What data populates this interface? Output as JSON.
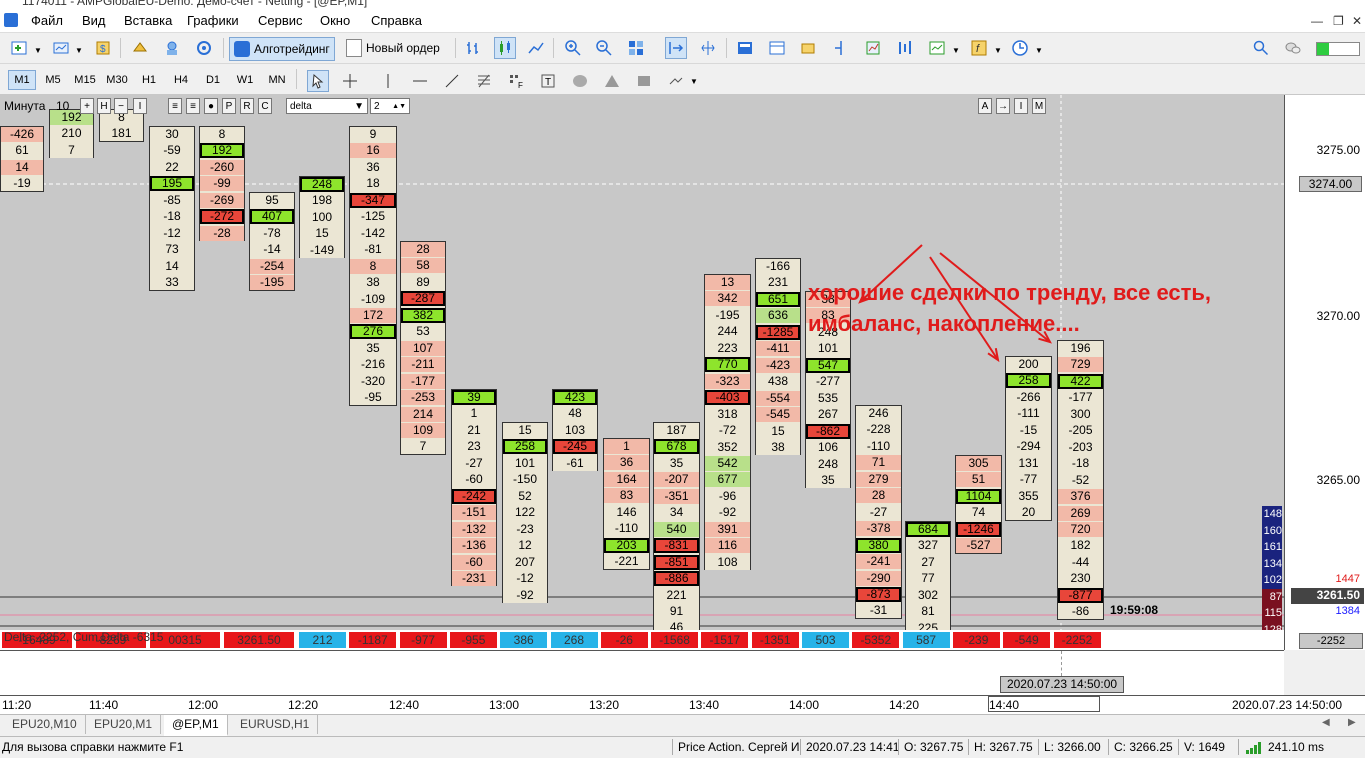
{
  "window": {
    "title": "1174011 - AMPGlobalEU-Demo: Демо-счет - Netting - [@EP,M1]"
  },
  "menu": [
    "Файл",
    "Вид",
    "Вставка",
    "Графики",
    "Сервис",
    "Окно",
    "Справка"
  ],
  "toolbar": {
    "algotrading_label": "Алготрейдинг",
    "new_order_label": "Новый ордер"
  },
  "timeframes": [
    "M1",
    "M5",
    "M15",
    "M30",
    "H1",
    "H4",
    "D1",
    "W1",
    "MN"
  ],
  "chart_controls": {
    "period_label": "Минута",
    "period_value": "10",
    "indicator": "delta",
    "indicator_value": "2",
    "buttons": [
      "+",
      "H",
      "−",
      "I",
      "≡",
      "≡",
      "●",
      "P",
      "R",
      "C"
    ],
    "right_buttons": [
      "A",
      "→",
      "I",
      "M"
    ]
  },
  "price_scale": {
    "labels": [
      "3275.00",
      "3274.00",
      "3270.00",
      "3265.00",
      "3261.50"
    ],
    "current_price": "3261.50",
    "crosshair_price": "3274.00",
    "volume_labels": [
      "148",
      "160",
      "161",
      "134",
      "102",
      "87",
      "115",
      "128"
    ],
    "right_values": [
      "1447",
      "1384"
    ],
    "delta_scale": "-2252"
  },
  "annotation": {
    "line1": "хорошие сделки по тренду, все есть,",
    "line2": "имбаланс, накопление...."
  },
  "footprint": [
    {
      "cells": [
        "-426",
        "61",
        "14",
        "-19"
      ],
      "colors": [
        "r",
        "w",
        "r",
        "w"
      ]
    },
    {
      "cells": [
        "192",
        "210",
        "7"
      ],
      "colors": [
        "g",
        "w",
        "w"
      ]
    },
    {
      "cells": [
        "8",
        "181"
      ],
      "colors": [
        "w",
        "w"
      ]
    },
    {
      "cells": [
        "30",
        "-59",
        "22",
        "195",
        "-85",
        "-18",
        "-12",
        "73",
        "14",
        "33"
      ],
      "colors": [
        "w",
        "w",
        "w",
        "G",
        "w",
        "w",
        "w",
        "w",
        "w",
        "w"
      ]
    },
    {
      "cells": [
        "8",
        "192",
        "-260",
        "-99",
        "-269",
        "-272",
        "-28"
      ],
      "colors": [
        "w",
        "G",
        "r",
        "r",
        "r",
        "R",
        "r"
      ]
    },
    {
      "cells": [
        "95",
        "407",
        "-78",
        "-14",
        "-254",
        "-195"
      ],
      "colors": [
        "w",
        "G",
        "w",
        "w",
        "r",
        "r"
      ]
    },
    {
      "cells": [
        "248",
        "198",
        "100",
        "15",
        "-149"
      ],
      "colors": [
        "G",
        "w",
        "w",
        "w",
        "w"
      ]
    },
    {
      "cells": [
        "9",
        "16",
        "36",
        "18",
        "-347",
        "-125",
        "-142",
        "-81",
        "8",
        "38",
        "-109",
        "172",
        "276",
        "35",
        "-216",
        "-320",
        "-95"
      ],
      "colors": [
        "w",
        "r",
        "w",
        "w",
        "R",
        "w",
        "w",
        "w",
        "r",
        "w",
        "w",
        "r",
        "G",
        "w",
        "w",
        "w",
        "w"
      ]
    },
    {
      "cells": [
        "28",
        "58",
        "89",
        "-287",
        "382",
        "53",
        "107",
        "-211",
        "-177",
        "-253",
        "214",
        "109",
        "7"
      ],
      "colors": [
        "r",
        "r",
        "w",
        "R",
        "G",
        "w",
        "r",
        "r",
        "r",
        "r",
        "r",
        "r",
        "w"
      ]
    },
    {
      "cells": [
        "39",
        "1",
        "21",
        "23",
        "-27",
        "-60",
        "-242",
        "-151",
        "-132",
        "-136",
        "-60",
        "-231"
      ],
      "colors": [
        "G",
        "w",
        "w",
        "w",
        "w",
        "w",
        "R",
        "r",
        "r",
        "r",
        "r",
        "r"
      ]
    },
    {
      "cells": [
        "15",
        "258",
        "101",
        "-150",
        "52",
        "122",
        "-23",
        "12",
        "207",
        "-12",
        "-92"
      ],
      "colors": [
        "w",
        "G",
        "w",
        "w",
        "w",
        "w",
        "w",
        "w",
        "w",
        "w",
        "w"
      ]
    },
    {
      "cells": [
        "423",
        "48",
        "103",
        "-245",
        "-61"
      ],
      "colors": [
        "G",
        "w",
        "w",
        "R",
        "w"
      ]
    },
    {
      "cells": [
        "1",
        "36",
        "164",
        "83",
        "146",
        "-110",
        "203",
        "-221"
      ],
      "colors": [
        "r",
        "r",
        "r",
        "r",
        "w",
        "w",
        "G",
        "w"
      ]
    },
    {
      "cells": [
        "187",
        "678",
        "35",
        "-207",
        "-351",
        "34",
        "540",
        "-831",
        "-851",
        "-886",
        "221",
        "91",
        "46"
      ],
      "colors": [
        "w",
        "G",
        "w",
        "r",
        "r",
        "w",
        "g",
        "R",
        "R",
        "R",
        "w",
        "w",
        "w"
      ]
    },
    {
      "cells": [
        "13",
        "342",
        "-195",
        "244",
        "223",
        "770",
        "-323",
        "-403",
        "318",
        "-72",
        "352",
        "542",
        "677",
        "-96",
        "-92",
        "391",
        "116",
        "108"
      ],
      "colors": [
        "r",
        "r",
        "w",
        "w",
        "w",
        "G",
        "r",
        "R",
        "w",
        "w",
        "w",
        "g",
        "g",
        "w",
        "w",
        "r",
        "r",
        "w"
      ]
    },
    {
      "cells": [
        "-166",
        "231",
        "651",
        "636",
        "-1285",
        "-411",
        "-423",
        "438",
        "-554",
        "-545",
        "15",
        "38"
      ],
      "colors": [
        "w",
        "w",
        "G",
        "g",
        "R",
        "r",
        "r",
        "w",
        "r",
        "r",
        "w",
        "w"
      ]
    },
    {
      "cells": [
        "38",
        "83",
        "248",
        "101",
        "547",
        "-277",
        "535",
        "267",
        "-862",
        "106",
        "248",
        "35"
      ],
      "colors": [
        "r",
        "r",
        "w",
        "w",
        "G",
        "w",
        "w",
        "w",
        "R",
        "w",
        "w",
        "w"
      ]
    },
    {
      "cells": [
        "246",
        "-228",
        "-110",
        "71",
        "279",
        "28",
        "-27",
        "-378",
        "380",
        "-241",
        "-290",
        "-873",
        "-31"
      ],
      "colors": [
        "w",
        "w",
        "w",
        "r",
        "r",
        "r",
        "w",
        "r",
        "G",
        "r",
        "r",
        "R",
        "w"
      ]
    },
    {
      "cells": [
        "684",
        "327",
        "27",
        "77",
        "302",
        "81",
        "225"
      ],
      "colors": [
        "G",
        "w",
        "w",
        "w",
        "w",
        "w",
        "w"
      ]
    },
    {
      "cells": [
        "305",
        "51",
        "1104",
        "74",
        "-1246",
        "-527"
      ],
      "colors": [
        "r",
        "r",
        "G",
        "w",
        "R",
        "r"
      ]
    },
    {
      "cells": [
        "200",
        "258",
        "-266",
        "-111",
        "-15",
        "-294",
        "131",
        "-77",
        "355",
        "20"
      ],
      "colors": [
        "w",
        "G",
        "w",
        "w",
        "w",
        "w",
        "w",
        "w",
        "w",
        "w"
      ]
    },
    {
      "cells": [
        "196",
        "729",
        "422",
        "-177",
        "300",
        "-205",
        "-203",
        "-18",
        "-52",
        "376",
        "269",
        "720",
        "182",
        "-44",
        "230",
        "-877",
        "-86"
      ],
      "colors": [
        "w",
        "r",
        "G",
        "w",
        "w",
        "w",
        "w",
        "w",
        "w",
        "r",
        "r",
        "r",
        "w",
        "w",
        "w",
        "R",
        "w"
      ]
    }
  ],
  "last_time": "19:59:08",
  "delta_bar": {
    "left_text": "Delta -2252, Cum.Delta -6315",
    "values": [
      "-16489",
      "-8269",
      "00315",
      "3261.50",
      "212",
      "-1187",
      "-977",
      "-955",
      "386",
      "268",
      "-26",
      "-1568",
      "-1517",
      "-1351",
      "503",
      "-5352",
      "587",
      "-239",
      "-549",
      "-2252"
    ]
  },
  "time_axis": {
    "labels": [
      "11:20",
      "11:40",
      "12:00",
      "12:20",
      "12:40",
      "13:00",
      "13:20",
      "13:40",
      "14:00",
      "14:20",
      "14:40"
    ],
    "cursor_label": "2020.07.23 14:50:00",
    "right_label": "2020.07.23 14:50:00"
  },
  "tabs": [
    "EPU20,M10",
    "EPU20,M1",
    "@EP,M1",
    "EURUSD,H1"
  ],
  "status": {
    "help": "Для вызова справки нажмите F1",
    "profile": "Price Action. Сергей И",
    "datetime": "2020.07.23 14:41",
    "open": "O: 3267.75",
    "high": "H: 3267.75",
    "low": "L: 3266.00",
    "close": "C: 3266.25",
    "volume": "V: 1649",
    "ping": "241.10 ms"
  }
}
